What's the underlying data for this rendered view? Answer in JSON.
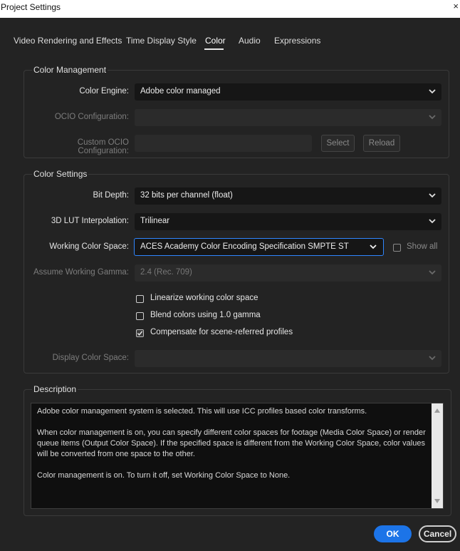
{
  "window": {
    "title": "Project Settings",
    "close_glyph": "×"
  },
  "tabs": [
    {
      "label": "Video Rendering and Effects"
    },
    {
      "label": "Time Display Style"
    },
    {
      "label": "Color"
    },
    {
      "label": "Audio"
    },
    {
      "label": "Expressions"
    }
  ],
  "active_tab": "Color",
  "color_management": {
    "title": "Color Management",
    "engine_label": "Color Engine:",
    "engine_value": "Adobe color managed",
    "ocio_label": "OCIO Configuration:",
    "ocio_value": "",
    "custom_ocio_label": "Custom OCIO Configuration:",
    "custom_ocio_value": "",
    "select_label": "Select",
    "reload_label": "Reload"
  },
  "color_settings": {
    "title": "Color Settings",
    "bit_depth_label": "Bit Depth:",
    "bit_depth_value": "32 bits per channel (float)",
    "lut_label": "3D LUT Interpolation:",
    "lut_value": "Trilinear",
    "wcs_label": "Working Color Space:",
    "wcs_value": "ACES Academy Color Encoding Specification SMPTE ST",
    "show_all_label": "Show all",
    "show_all_checked": false,
    "gamma_label": "Assume Working Gamma:",
    "gamma_value": "2.4 (Rec. 709)",
    "checkboxes": [
      {
        "label": "Linearize working color space",
        "checked": false
      },
      {
        "label": "Blend colors using 1.0 gamma",
        "checked": false
      },
      {
        "label": "Compensate for scene-referred profiles",
        "checked": true
      }
    ],
    "display_label": "Display Color Space:",
    "display_value": ""
  },
  "description": {
    "title": "Description",
    "p1": "Adobe color management system is selected. This will use ICC profiles based color transforms.",
    "p2_line1": "When color management is on, you can specify different color spaces for footage (Media Color Space) or render",
    "p2_line2": "queue items (Output Color Space). If the specified space is different from the Working Color Space, color values",
    "p2_line3": "will be converted from one space to the other.",
    "p3": "Color management is on. To turn it off, set Working Color Space to None."
  },
  "buttons": {
    "ok": "OK",
    "cancel": "Cancel"
  },
  "colors": {
    "accent": "#1c74e8",
    "focus_border": "#2f86ff",
    "background": "#232323"
  },
  "icons": {
    "dropdown": "chevron-down-icon",
    "check": "check-icon",
    "close": "close-icon"
  }
}
